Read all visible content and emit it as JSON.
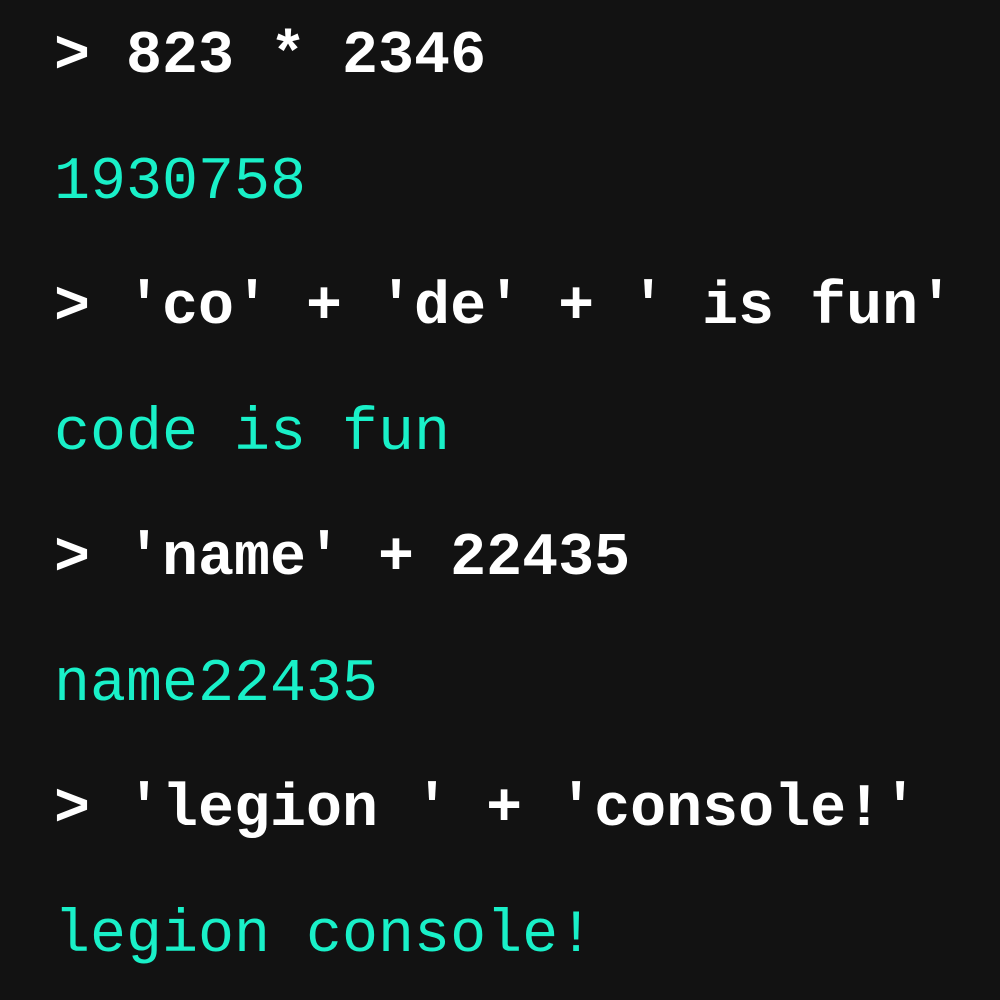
{
  "colors": {
    "background": "#121212",
    "input_text": "#ffffff",
    "output_text": "#19f0c8"
  },
  "entries": [
    {
      "input": "> 823 * 2346",
      "output": "1930758"
    },
    {
      "input": "> 'co' + 'de' + ' is fun'",
      "output": "code is fun"
    },
    {
      "input": "> 'name' + 22435",
      "output": "name22435"
    },
    {
      "input": "> 'legion ' + 'console!'",
      "output": "legion console!"
    }
  ]
}
